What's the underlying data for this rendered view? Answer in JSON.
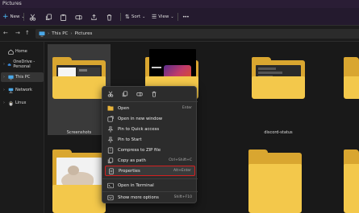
{
  "window": {
    "title": "Pictures"
  },
  "toolbar": {
    "new_label": "New",
    "sort_label": "Sort",
    "view_label": "View",
    "more_label": "•••"
  },
  "address": {
    "root": "This PC",
    "separator": "›",
    "current": "Pictures"
  },
  "sidebar": {
    "items": [
      {
        "label": "Home",
        "icon": "home-icon"
      },
      {
        "label": "OneDrive - Personal",
        "icon": "cloud-icon"
      },
      {
        "label": "This PC",
        "icon": "computer-icon",
        "active": true
      },
      {
        "label": "Network",
        "icon": "network-icon"
      },
      {
        "label": "Linux",
        "icon": "penguin-icon"
      }
    ]
  },
  "folders": [
    {
      "label": "Screenshots",
      "selected": true
    },
    {
      "label": ""
    },
    {
      "label": "discord-status"
    },
    {
      "label": ""
    },
    {
      "label": ""
    },
    {
      "label": ""
    },
    {
      "label": ""
    }
  ],
  "context_menu": {
    "quick_actions": [
      "cut-icon",
      "copy-icon",
      "rename-icon",
      "delete-icon"
    ],
    "items": [
      {
        "label": "Open",
        "shortcut": "Enter"
      },
      {
        "label": "Open in new window",
        "shortcut": ""
      },
      {
        "label": "Pin to Quick access",
        "shortcut": ""
      },
      {
        "label": "Pin to Start",
        "shortcut": ""
      },
      {
        "label": "Compress to ZIP file",
        "shortcut": ""
      },
      {
        "label": "Copy as path",
        "shortcut": "Ctrl+Shift+C"
      },
      {
        "label": "Properties",
        "shortcut": "Alt+Enter",
        "highlighted": true
      },
      {
        "label": "Open in Terminal",
        "shortcut": ""
      },
      {
        "label": "Show more options",
        "shortcut": "Shift+F10"
      }
    ]
  },
  "colors": {
    "folder_front": "#f3c84b",
    "folder_back": "#d9a630",
    "highlight_border": "#d42020",
    "accent": "#4cc2ff"
  }
}
